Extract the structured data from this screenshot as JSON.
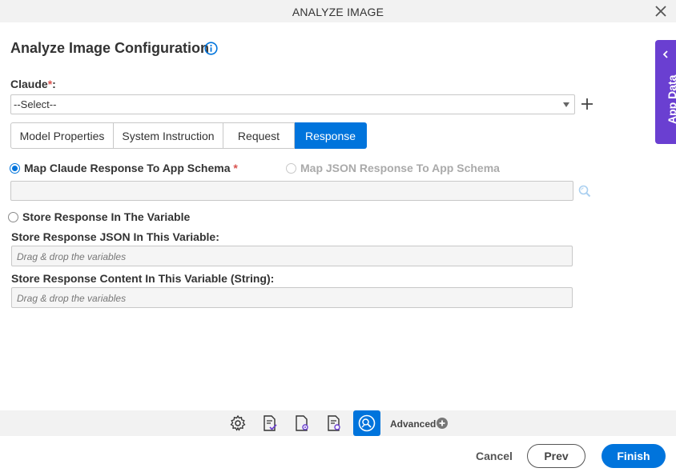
{
  "window": {
    "title": "ANALYZE IMAGE",
    "close_icon": "close-icon"
  },
  "heading": {
    "title": "Analyze Image Configuration",
    "info_icon": "info-icon"
  },
  "model_field": {
    "label": "Claude",
    "required_mark": "*",
    "colon": ":",
    "value": "--Select--",
    "add_icon": "plus-icon"
  },
  "tabs": [
    {
      "label": "Model Properties",
      "active": false
    },
    {
      "label": "System Instruction",
      "active": false
    },
    {
      "label": "Request",
      "active": false
    },
    {
      "label": "Response",
      "active": true
    }
  ],
  "response": {
    "map_claude": {
      "label": "Map Claude Response To App Schema",
      "required_mark": "*",
      "selected": true
    },
    "map_json": {
      "label": "Map JSON Response To App Schema",
      "selected": false,
      "disabled": true
    },
    "schema_value": "",
    "store_variable": {
      "label": "Store Response In The Variable",
      "selected": false
    },
    "json_var": {
      "label": "Store Response JSON In This Variable:",
      "placeholder": "Drag & drop the variables"
    },
    "content_var": {
      "label": "Store Response Content In This Variable (String):",
      "placeholder": "Drag & drop the variables"
    }
  },
  "side_panel": {
    "label": "App Data",
    "icon": "chevron-left-icon"
  },
  "toolbar": {
    "tools": [
      "gear-icon",
      "document-check-icon",
      "document-settings-icon",
      "document-gear-icon",
      "image-analyze-icon"
    ],
    "advanced_label": "Advanced",
    "advanced_icon": "plus-circle-icon"
  },
  "footer": {
    "cancel": "Cancel",
    "prev": "Prev",
    "finish": "Finish"
  },
  "colors": {
    "accent": "#0074dc",
    "side_tab": "#6a3fd1",
    "required": "#d9534f"
  }
}
